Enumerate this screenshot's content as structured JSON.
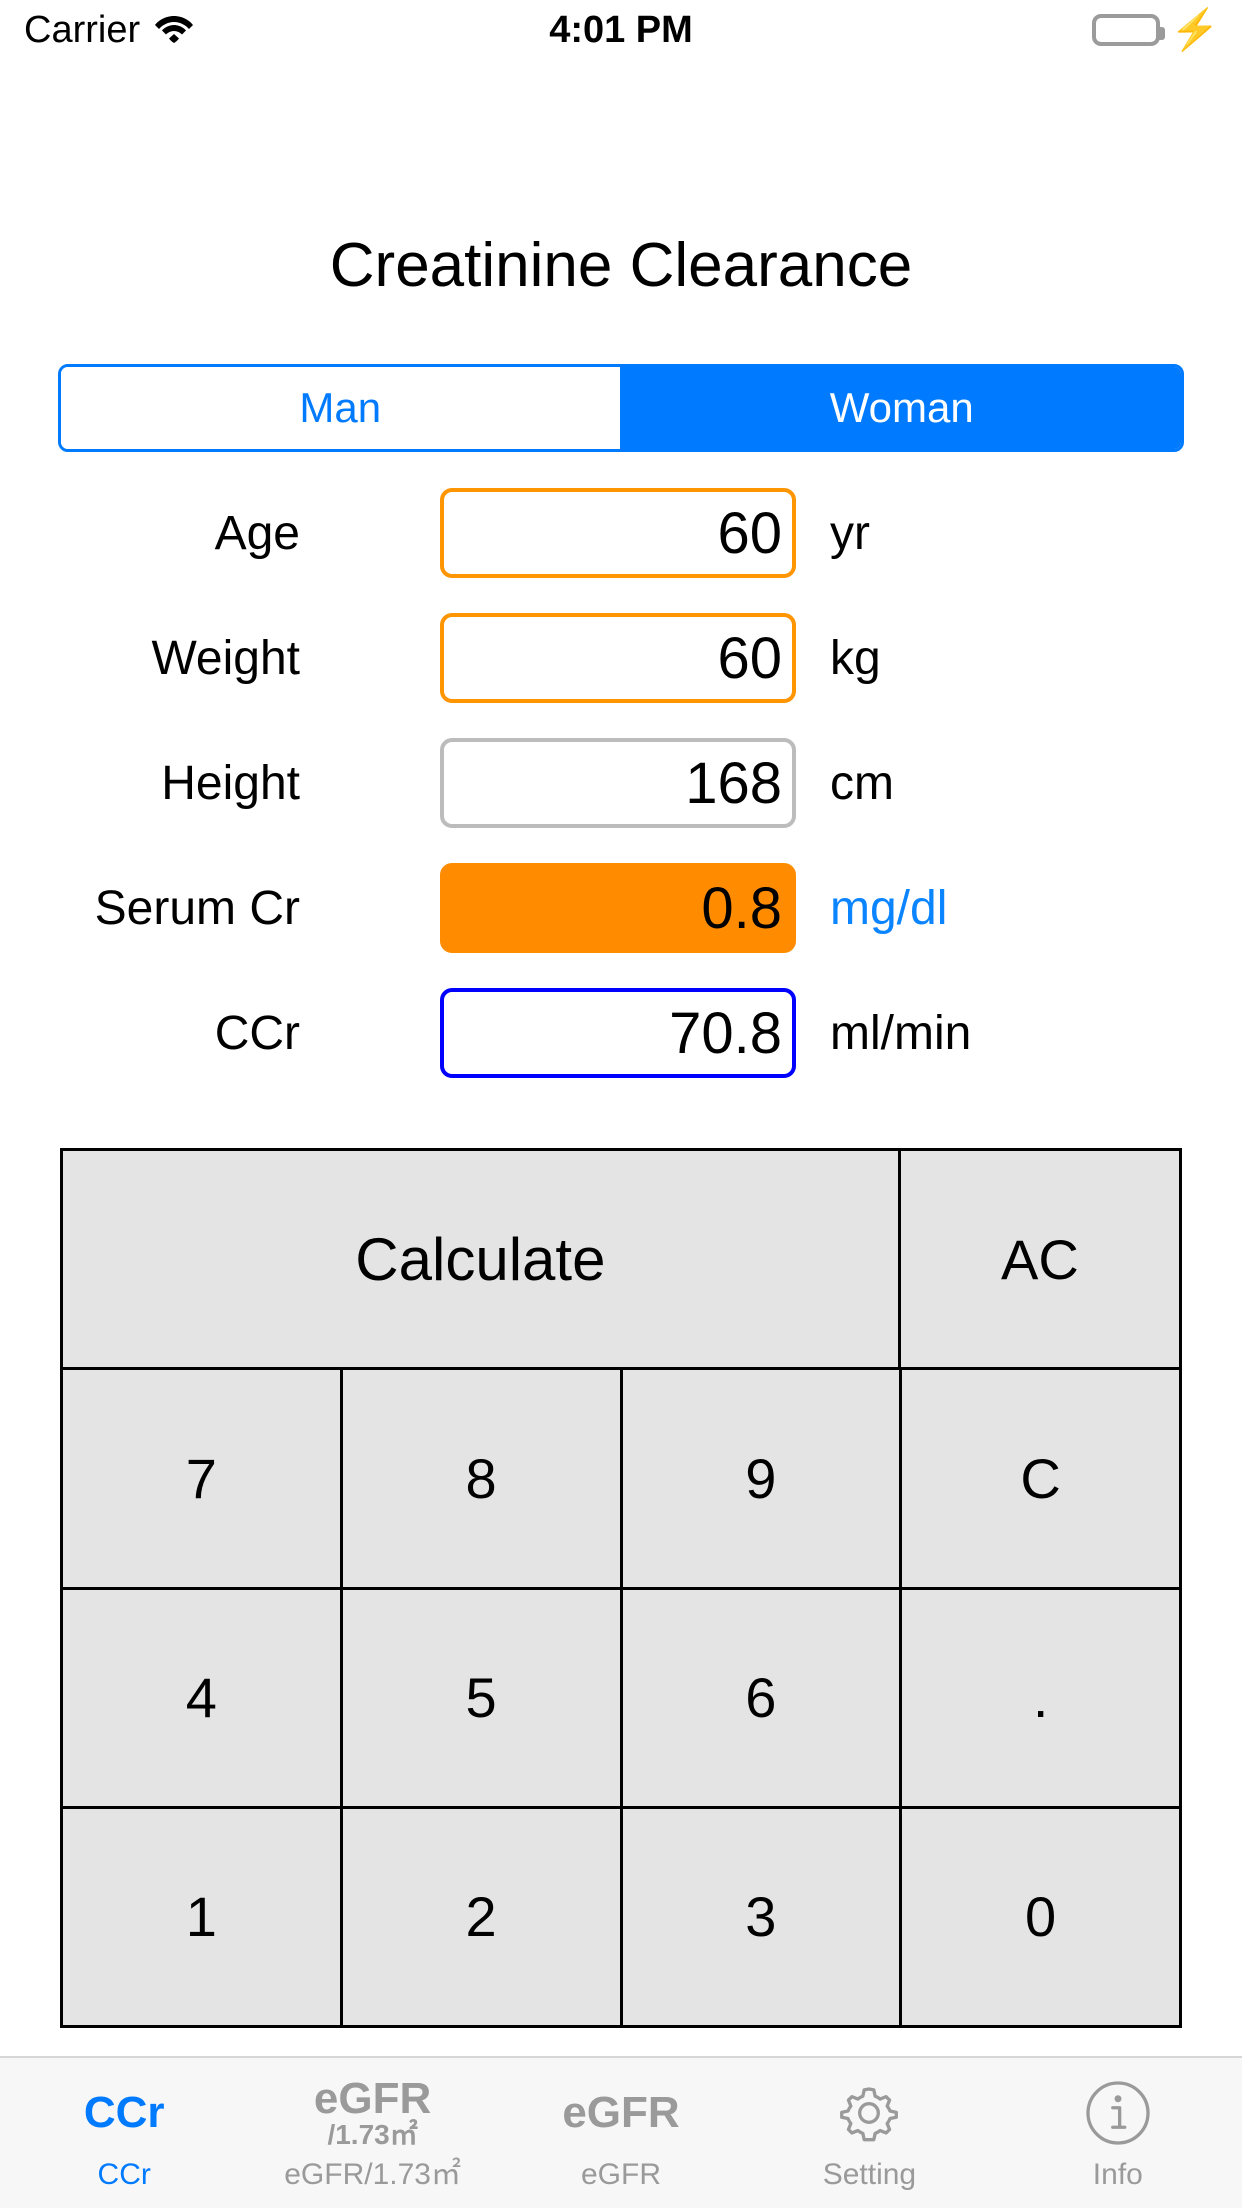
{
  "statusbar": {
    "carrier": "Carrier",
    "time": "4:01 PM",
    "wifi_icon": "wifi-icon",
    "battery_icon": "battery-full-icon",
    "charging_icon": "lightning-bolt-icon",
    "battery_color": "#4cd964"
  },
  "header": {
    "title": "Creatinine Clearance"
  },
  "gender_segment": {
    "options": [
      "Man",
      "Woman"
    ],
    "selected": "Woman",
    "accent_color": "#007aff"
  },
  "fields": [
    {
      "label": "Age",
      "value": "60",
      "unit": "yr",
      "style": "orange",
      "unit_link": false
    },
    {
      "label": "Weight",
      "value": "60",
      "unit": "kg",
      "style": "orange",
      "unit_link": false
    },
    {
      "label": "Height",
      "value": "168",
      "unit": "cm",
      "style": "gray",
      "unit_link": false
    },
    {
      "label": "Serum Cr",
      "value": "0.8",
      "unit": "mg/dl",
      "style": "filled",
      "unit_link": true
    },
    {
      "label": "CCr",
      "value": "70.8",
      "unit": "ml/min",
      "style": "blue",
      "unit_link": false
    }
  ],
  "keypad": {
    "calculate_label": "Calculate",
    "ac_label": "AC",
    "rows": [
      [
        "7",
        "8",
        "9",
        "C"
      ],
      [
        "4",
        "5",
        "6",
        "."
      ],
      [
        "1",
        "2",
        "3",
        "0"
      ]
    ],
    "key_bg": "#e4e4e4"
  },
  "tabbar": {
    "active": "CCr",
    "tabs": [
      {
        "icon_line1": "CCr",
        "icon_line2": "",
        "label": "CCr",
        "icon_name": "ccr-text-icon",
        "active": true
      },
      {
        "icon_line1": "eGFR",
        "icon_line2": "/1.73㎡",
        "label": "eGFR/1.73㎡",
        "icon_name": "egfr-bsa-text-icon",
        "active": false
      },
      {
        "icon_line1": "eGFR",
        "icon_line2": "",
        "label": "eGFR",
        "icon_name": "egfr-text-icon",
        "active": false
      },
      {
        "icon_line1": "",
        "icon_line2": "",
        "label": "Setting",
        "icon_name": "gear-icon",
        "active": false
      },
      {
        "icon_line1": "",
        "icon_line2": "",
        "label": "Info",
        "icon_name": "info-circle-icon",
        "active": false
      }
    ],
    "active_color": "#007aff",
    "inactive_color": "#9a9a9a"
  }
}
